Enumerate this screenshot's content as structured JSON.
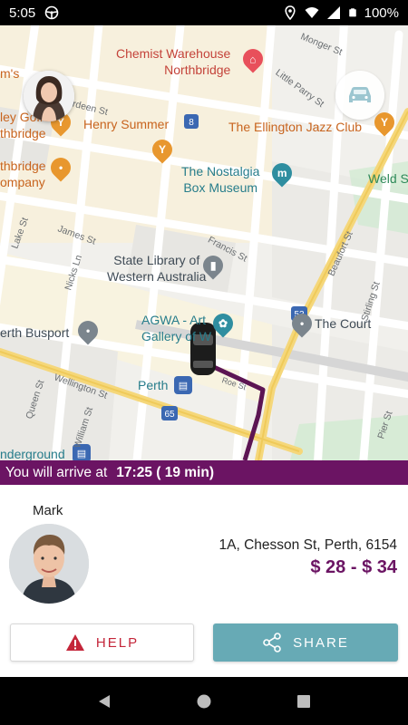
{
  "status_bar": {
    "time": "5:05",
    "battery": "100%"
  },
  "map": {
    "pois": [
      {
        "id": "chemist",
        "text": "Chemist Warehouse",
        "text2": "Northbridge",
        "color": "red"
      },
      {
        "id": "henry",
        "text": "Henry Summer",
        "color": "orange"
      },
      {
        "id": "ellington",
        "text": "The Ellington Jazz Club",
        "color": "orange"
      },
      {
        "id": "nostalgia",
        "text": "The Nostalgia",
        "text2": "Box Museum",
        "color": "teal"
      },
      {
        "id": "library",
        "text": "State Library of",
        "text2": "Western Australia",
        "color": "dark"
      },
      {
        "id": "agwa",
        "text": "AGWA - Art",
        "text2": "Gallery of W",
        "color": "teal"
      },
      {
        "id": "court",
        "text": "The Court",
        "color": "dark"
      },
      {
        "id": "busport",
        "text": "erth Busport",
        "color": "dark"
      },
      {
        "id": "perth",
        "text": "Perth",
        "color": "teal"
      },
      {
        "id": "underground",
        "text": "nderground",
        "color": "teal"
      },
      {
        "id": "golf",
        "text": "ley Golf",
        "text2": "thbridge",
        "color": "orange"
      },
      {
        "id": "company",
        "text": "thbridge",
        "text2": "ompany",
        "color": "orange"
      },
      {
        "id": "weld",
        "text": "Weld S",
        "color": "green"
      },
      {
        "id": "ms",
        "text": "m's",
        "color": "orange"
      }
    ],
    "streets": [
      {
        "id": "monger",
        "text": "Monger St"
      },
      {
        "id": "parry",
        "text": "Little Parry St"
      },
      {
        "id": "aberdeen",
        "text": "Aberdeen St"
      },
      {
        "id": "james",
        "text": "James St"
      },
      {
        "id": "francis",
        "text": "Francis St"
      },
      {
        "id": "beaufort",
        "text": "Beaufort St"
      },
      {
        "id": "lake",
        "text": "Lake St"
      },
      {
        "id": "nicks",
        "text": "Nicks Ln"
      },
      {
        "id": "stirling",
        "text": "Stirling St"
      },
      {
        "id": "wellington",
        "text": "Wellington St"
      },
      {
        "id": "queen",
        "text": "Queen St"
      },
      {
        "id": "william",
        "text": "William St"
      },
      {
        "id": "pier",
        "text": "Pier St"
      },
      {
        "id": "roe",
        "text": "Roe St"
      }
    ],
    "route_badges": [
      "8",
      "53",
      "65"
    ]
  },
  "arrival": {
    "prefix": "You will arrive at",
    "time": "17:25 ( 19 min)"
  },
  "driver": {
    "name": "Mark",
    "address": "1A, Chesson St, Perth, 6154",
    "price": "$ 28 - $ 34"
  },
  "actions": {
    "help_label": "HELP",
    "share_label": "SHARE"
  },
  "colors": {
    "brand": "#6b1463",
    "share": "#67aab5",
    "help": "#c4263a"
  }
}
